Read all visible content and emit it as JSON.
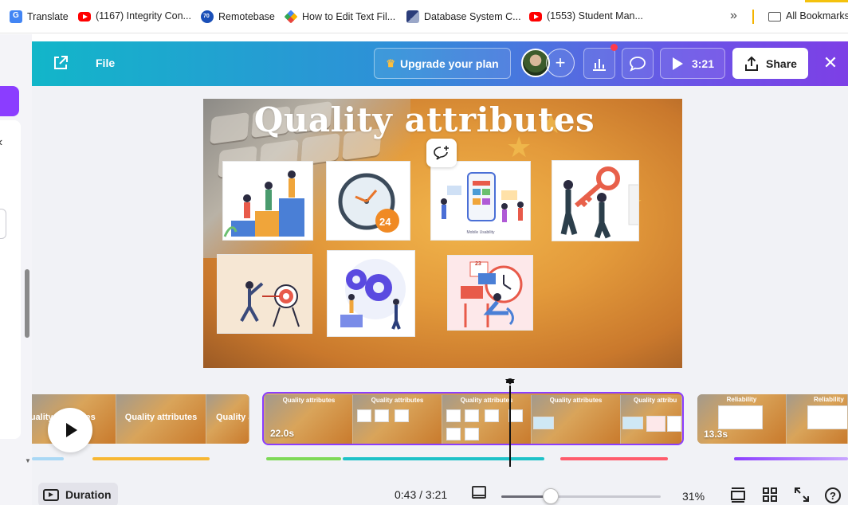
{
  "bookmarks": {
    "items": [
      {
        "label": "Translate",
        "icon": "google-translate-icon"
      },
      {
        "label": "(1167) Integrity Con...",
        "icon": "youtube-icon"
      },
      {
        "label": "Remotebase",
        "icon": "remotebase-icon"
      },
      {
        "label": "How to Edit Text Fil...",
        "icon": "site-favicon"
      },
      {
        "label": "Database System C...",
        "icon": "database-site-icon"
      },
      {
        "label": "(1553) Student Man...",
        "icon": "youtube-icon"
      }
    ],
    "more": "»",
    "all_bookmarks": "All Bookmarks"
  },
  "header": {
    "file_label": "File",
    "upgrade_label": "Upgrade your plan",
    "present_time": "3:21",
    "share_label": "Share",
    "colors": {
      "gradient_start": "#12b6c9",
      "gradient_end": "#7d3fe6",
      "notification": "#ff3b4b"
    }
  },
  "slide": {
    "title": "Quality attributes",
    "mobile_tile_caption": "Mobile Usability",
    "clock_badge": "24",
    "calendar_date": "23"
  },
  "timeline": {
    "clips": [
      {
        "labels": [
          "Quality attributes",
          "Quality attributes",
          "Quality a"
        ]
      },
      {
        "frame_labels": [
          "Quality attributes",
          "Quality attributes",
          "Quality attributes",
          "Quality attributes",
          "Quality attribu"
        ],
        "duration": "22.0s",
        "selected": true
      },
      {
        "frame_labels": [
          "Reliability",
          "Reliability"
        ],
        "duration": "13.3s"
      }
    ],
    "accent": "#8b3dff"
  },
  "bottom": {
    "duration_label": "Duration",
    "time_readout": "0:43 / 3:21",
    "zoom_percent": "31%",
    "zoom_level": 0.31,
    "help": "?"
  }
}
